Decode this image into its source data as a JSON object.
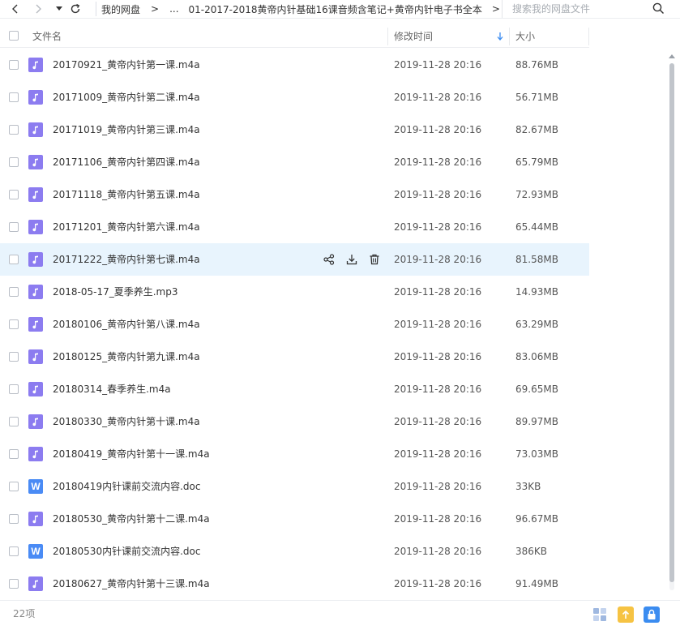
{
  "breadcrumb": {
    "root": "我的网盘",
    "ellipsis": "...",
    "current": "01-2017-2018黄帝内针基础16课音频含笔记+黄帝内针电子书全本",
    "sep": ">"
  },
  "search": {
    "placeholder": "搜索我的网盘文件"
  },
  "columns": {
    "name": "文件名",
    "modified": "修改时间",
    "size": "大小"
  },
  "files": [
    {
      "name": "20170921_黄帝内针第一课.m4a",
      "time": "2019-11-28 20:16",
      "size": "88.76MB",
      "type": "audio"
    },
    {
      "name": "20171009_黄帝内针第二课.m4a",
      "time": "2019-11-28 20:16",
      "size": "56.71MB",
      "type": "audio"
    },
    {
      "name": "20171019_黄帝内针第三课.m4a",
      "time": "2019-11-28 20:16",
      "size": "82.67MB",
      "type": "audio"
    },
    {
      "name": "20171106_黄帝内针第四课.m4a",
      "time": "2019-11-28 20:16",
      "size": "65.79MB",
      "type": "audio"
    },
    {
      "name": "20171118_黄帝内针第五课.m4a",
      "time": "2019-11-28 20:16",
      "size": "72.93MB",
      "type": "audio"
    },
    {
      "name": "20171201_黄帝内针第六课.m4a",
      "time": "2019-11-28 20:16",
      "size": "65.44MB",
      "type": "audio"
    },
    {
      "name": "20171222_黄帝内针第七课.m4a",
      "time": "2019-11-28 20:16",
      "size": "81.58MB",
      "type": "audio",
      "hover": true
    },
    {
      "name": "2018-05-17_夏季养生.mp3",
      "time": "2019-11-28 20:16",
      "size": "14.93MB",
      "type": "audio"
    },
    {
      "name": "20180106_黄帝内针第八课.m4a",
      "time": "2019-11-28 20:16",
      "size": "63.29MB",
      "type": "audio"
    },
    {
      "name": "20180125_黄帝内针第九课.m4a",
      "time": "2019-11-28 20:16",
      "size": "83.06MB",
      "type": "audio"
    },
    {
      "name": "20180314_春季养生.m4a",
      "time": "2019-11-28 20:16",
      "size": "69.65MB",
      "type": "audio"
    },
    {
      "name": "20180330_黄帝内针第十课.m4a",
      "time": "2019-11-28 20:16",
      "size": "89.97MB",
      "type": "audio"
    },
    {
      "name": "20180419_黄帝内针第十一课.m4a",
      "time": "2019-11-28 20:16",
      "size": "73.03MB",
      "type": "audio"
    },
    {
      "name": "20180419内针课前交流内容.doc",
      "time": "2019-11-28 20:16",
      "size": "33KB",
      "type": "doc"
    },
    {
      "name": "20180530_黄帝内针第十二课.m4a",
      "time": "2019-11-28 20:16",
      "size": "96.67MB",
      "type": "audio"
    },
    {
      "name": "20180530内针课前交流内容.doc",
      "time": "2019-11-28 20:16",
      "size": "386KB",
      "type": "doc"
    },
    {
      "name": "20180627_黄帝内针第十三课.m4a",
      "time": "2019-11-28 20:16",
      "size": "91.49MB",
      "type": "audio"
    }
  ],
  "icons": {
    "audio": "music-note-icon",
    "doc": "word-doc-icon",
    "doc_glyph": "W"
  },
  "colors": {
    "audio_icon": "#8c7cf0",
    "doc_icon": "#4a8bf5",
    "hover_row": "#e8f4fd",
    "sort_arrow": "#3b8cf0"
  },
  "footer": {
    "count": "22项"
  }
}
